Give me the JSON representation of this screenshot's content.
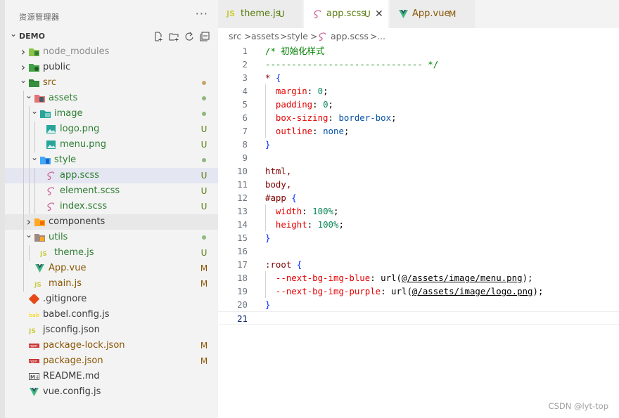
{
  "explorer": {
    "title": "资源管理器",
    "more": "···",
    "root_label": "DEMO",
    "root_actions": [
      "new-file-icon",
      "new-folder-icon",
      "refresh-icon",
      "collapse-all-icon"
    ],
    "items": [
      {
        "label": "node_modules",
        "depth": 0,
        "type": "folder-collapsed",
        "status": "",
        "icon": "node-modules-folder-icon"
      },
      {
        "label": "public",
        "depth": 0,
        "type": "folder-collapsed",
        "status": "",
        "icon": "public-folder-icon"
      },
      {
        "label": "src",
        "depth": 0,
        "type": "folder-open",
        "status": "•",
        "icon": "src-folder-icon"
      },
      {
        "label": "assets",
        "depth": 1,
        "type": "folder-open",
        "status": "•",
        "icon": "assets-folder-icon"
      },
      {
        "label": "image",
        "depth": 2,
        "type": "folder-open",
        "status": "•",
        "icon": "image-folder-icon"
      },
      {
        "label": "logo.png",
        "depth": 3,
        "type": "file",
        "status": "U",
        "icon": "image-file-icon"
      },
      {
        "label": "menu.png",
        "depth": 3,
        "type": "file",
        "status": "U",
        "icon": "image-file-icon"
      },
      {
        "label": "style",
        "depth": 2,
        "type": "folder-open",
        "status": "•",
        "icon": "style-folder-icon"
      },
      {
        "label": "app.scss",
        "depth": 3,
        "type": "file",
        "status": "U",
        "icon": "sass-file-icon"
      },
      {
        "label": "element.scss",
        "depth": 3,
        "type": "file",
        "status": "U",
        "icon": "sass-file-icon"
      },
      {
        "label": "index.scss",
        "depth": 3,
        "type": "file",
        "status": "U",
        "icon": "sass-file-icon"
      },
      {
        "label": "components",
        "depth": 1,
        "type": "folder-collapsed",
        "status": "",
        "icon": "components-folder-icon"
      },
      {
        "label": "utils",
        "depth": 1,
        "type": "folder-open",
        "status": "•",
        "icon": "utils-folder-icon"
      },
      {
        "label": "theme.js",
        "depth": 2,
        "type": "file",
        "status": "U",
        "icon": "js-file-icon"
      },
      {
        "label": "App.vue",
        "depth": 1,
        "type": "file",
        "status": "M",
        "icon": "vue-file-icon"
      },
      {
        "label": "main.js",
        "depth": 1,
        "type": "file",
        "status": "M",
        "icon": "js-file-icon"
      },
      {
        "label": ".gitignore",
        "depth": 0,
        "type": "file",
        "status": "",
        "icon": "git-file-icon"
      },
      {
        "label": "babel.config.js",
        "depth": 0,
        "type": "file",
        "status": "",
        "icon": "babel-file-icon"
      },
      {
        "label": "jsconfig.json",
        "depth": 0,
        "type": "file",
        "status": "",
        "icon": "js-file-icon"
      },
      {
        "label": "package-lock.json",
        "depth": 0,
        "type": "file",
        "status": "M",
        "icon": "npm-file-icon"
      },
      {
        "label": "package.json",
        "depth": 0,
        "type": "file",
        "status": "M",
        "icon": "npm-file-icon"
      },
      {
        "label": "README.md",
        "depth": 0,
        "type": "file",
        "status": "",
        "icon": "markdown-file-icon"
      },
      {
        "label": "vue.config.js",
        "depth": 0,
        "type": "file",
        "status": "",
        "icon": "vue-file-icon"
      }
    ]
  },
  "tabs": [
    {
      "label": "theme.js",
      "status": "U",
      "icon_text": "JS",
      "active": false
    },
    {
      "label": "app.scss",
      "status": "U",
      "icon_text": "",
      "active": true,
      "close": "✕"
    },
    {
      "label": "App.vue",
      "status": "M",
      "icon_text": "",
      "active": false
    }
  ],
  "breadcrumb": [
    "src",
    "assets",
    "style",
    "app.scss",
    "..."
  ],
  "breadcrumb_sep": ">",
  "code_lines": [
    "/* 初始化样式",
    "------------------------------ */",
    "* {",
    "  margin: 0;",
    "  padding: 0;",
    "  box-sizing: border-box;",
    "  outline: none;",
    "}",
    "",
    "html,",
    "body,",
    "#app {",
    "  width: 100%;",
    "  height: 100%;",
    "}",
    "",
    ":root {",
    "  --next-bg-img-blue: url(@/assets/image/menu.png);",
    "  --next-bg-img-purple: url(@/assets/image/logo.png);",
    "}",
    ""
  ],
  "current_line": 21,
  "watermark": "CSDN @lyt-top",
  "colors": {
    "untracked": "#587c0c",
    "modified": "#895503",
    "selection": "#e4e6f1",
    "comment": "#008000",
    "property": "#e50000",
    "number": "#098658",
    "value": "#0451a5"
  }
}
